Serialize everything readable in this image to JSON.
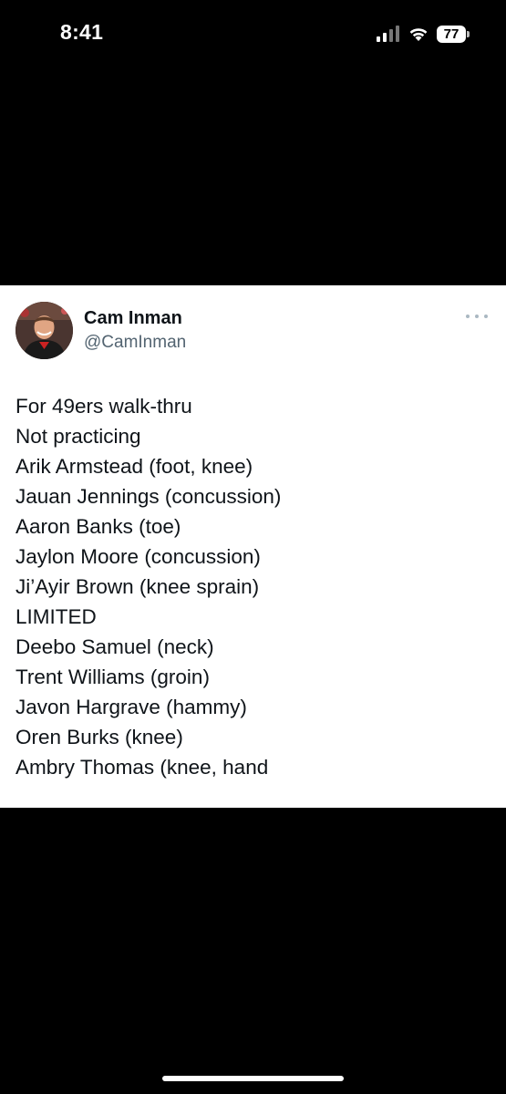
{
  "status_bar": {
    "time": "8:41",
    "battery": "77",
    "icons": [
      "signal-icon",
      "wifi-icon",
      "battery-icon"
    ]
  },
  "tweet": {
    "author": {
      "name": "Cam Inman",
      "handle": "@CamInman"
    },
    "lines": [
      "For 49ers walk-thru",
      "Not practicing",
      "Arik Armstead (foot, knee)",
      "Jauan Jennings (concussion)",
      "Aaron Banks (toe)",
      "Jaylon Moore (concussion)",
      "Ji’Ayir Brown (knee sprain)",
      "LIMITED",
      "Deebo Samuel (neck)",
      "Trent Williams (groin)",
      "Javon Hargrave (hammy)",
      "Oren Burks (knee)",
      "Ambry Thomas (knee, hand"
    ],
    "more_icon": "more-horizontal-icon"
  },
  "colors": {
    "background": "#000000",
    "card": "#ffffff",
    "text": "#0f1419",
    "secondary_text": "#536471"
  }
}
